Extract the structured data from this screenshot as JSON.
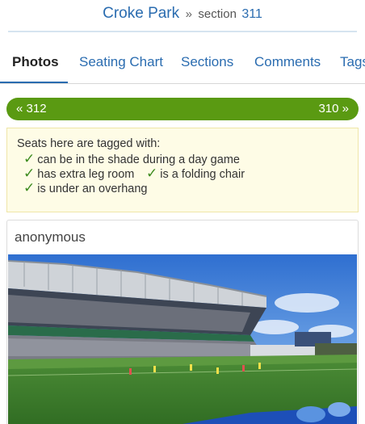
{
  "breadcrumb": {
    "venue": "Croke Park",
    "separator": "»",
    "section_word": "section",
    "section_number": "311"
  },
  "tabs": [
    {
      "label": "Photos",
      "active": true
    },
    {
      "label": "Seating Chart",
      "active": false
    },
    {
      "label": "Sections",
      "active": false
    },
    {
      "label": "Comments",
      "active": false
    },
    {
      "label": "Tags",
      "active": false
    }
  ],
  "pager": {
    "prev_label": "« 312",
    "next_label": "310 »"
  },
  "seat_tags": {
    "intro": "Seats here are tagged with:",
    "items": [
      "can be in the shade during a day game",
      "has extra leg room",
      "is a folding chair",
      "is under an overhang"
    ]
  },
  "photo_card": {
    "author": "anonymous"
  },
  "colors": {
    "link_blue": "#2a6cb0",
    "pager_green": "#5a9a12",
    "tag_box_bg": "#fefce6",
    "check_green": "#3d8b1f"
  }
}
